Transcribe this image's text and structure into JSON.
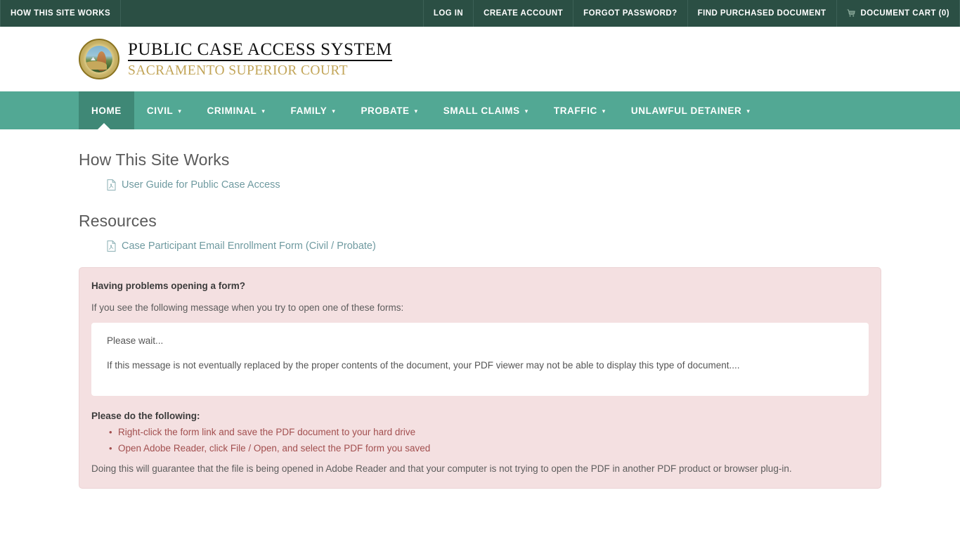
{
  "topbar": {
    "left_items": [
      {
        "label": "HOW THIS SITE WORKS",
        "icon": null
      }
    ],
    "right_items": [
      {
        "label": "LOG IN",
        "icon": null
      },
      {
        "label": "CREATE ACCOUNT",
        "icon": null
      },
      {
        "label": "FORGOT PASSWORD?",
        "icon": null
      },
      {
        "label": "FIND PURCHASED DOCUMENT",
        "icon": null
      },
      {
        "label": "DOCUMENT CART (0)",
        "icon": "shopping-cart-icon"
      }
    ],
    "background_color": "#2b4f44"
  },
  "banner": {
    "logo_icon": "sacramento-county-court-seal-icon",
    "title": "PUBLIC CASE ACCESS SYSTEM",
    "subtitle": "SACRAMENTO SUPERIOR COURT",
    "subtitle_color": "#c2a558"
  },
  "nav": {
    "background_color": "#52a894",
    "active_color": "#3f8876",
    "items": [
      {
        "label": "HOME",
        "has_caret": false,
        "active": true
      },
      {
        "label": "CIVIL",
        "has_caret": true,
        "active": false
      },
      {
        "label": "CRIMINAL",
        "has_caret": true,
        "active": false
      },
      {
        "label": "FAMILY",
        "has_caret": true,
        "active": false
      },
      {
        "label": "PROBATE",
        "has_caret": true,
        "active": false
      },
      {
        "label": "SMALL CLAIMS",
        "has_caret": true,
        "active": false
      },
      {
        "label": "TRAFFIC",
        "has_caret": true,
        "active": false
      },
      {
        "label": "UNLAWFUL DETAINER",
        "has_caret": true,
        "active": false
      }
    ]
  },
  "main": {
    "sections": [
      {
        "heading": "How This Site Works",
        "link_label": "User Guide for Public Case Access",
        "link_icon": "pdf-file-icon"
      },
      {
        "heading": "Resources",
        "link_label": "Case Participant Email Enrollment Form (Civil / Probate)",
        "link_icon": "pdf-file-icon"
      }
    ],
    "link_color": "#6f9aa0"
  },
  "alert": {
    "background_color": "#f4e0e1",
    "title": "Having problems opening a form?",
    "lead": "If you see the following message when you try to open one of these forms:",
    "message_box": {
      "line1": "Please wait...",
      "line2": "If this message is not eventually replaced by the proper contents of the document, your PDF viewer may not be able to display this type of document...."
    },
    "subtitle": "Please do the following:",
    "steps": [
      "Right-click the form link and save the PDF document to your hard drive",
      "Open Adobe Reader, click File / Open, and select the PDF form you saved"
    ],
    "steps_color": "#a24f4f",
    "footer": "Doing this will guarantee that the file is being opened in Adobe Reader and that your computer is not trying to open the PDF in another PDF product or browser plug-in."
  }
}
